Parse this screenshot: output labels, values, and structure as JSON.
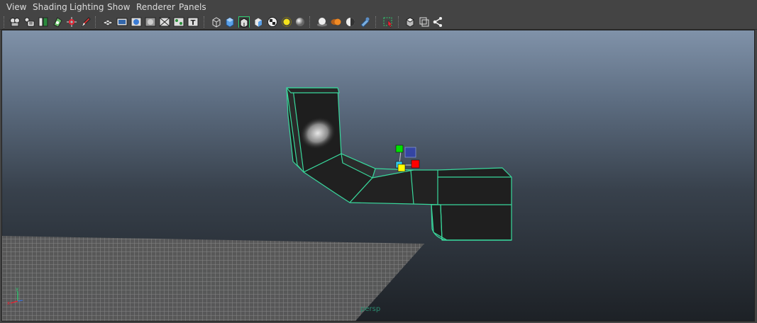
{
  "menubar": {
    "items": [
      "View",
      "Shading",
      "Lighting",
      "Show",
      "Renderer",
      "Panels"
    ]
  },
  "toolbar": {
    "icons": [
      "select-camera-icon",
      "camera-attributes-icon",
      "bookmark-icon",
      "image-plane-icon",
      "2d-pan-zoom-icon",
      "grease-pencil-icon",
      "grid-icon",
      "film-gate-icon",
      "resolution-gate-icon",
      "gate-mask-icon",
      "field-chart-icon",
      "safe-action-icon",
      "safe-title-icon",
      "wireframe-icon",
      "smooth-shade-icon",
      "wireframe-on-shaded-icon",
      "default-material-icon",
      "textured-icon",
      "use-all-lights-icon",
      "shadows-icon",
      "screen-space-ao-icon",
      "motion-blur-icon",
      "multisample-aa-icon",
      "depth-of-field-icon",
      "isolate-select-icon",
      "xray-icon",
      "xray-active-components-icon",
      "xray-joints-icon"
    ]
  },
  "viewport": {
    "camera_label": "persp",
    "background_top": "#8092a9",
    "background_bottom": "#1d2126",
    "wire_color": "#39d89c"
  },
  "manipulator": {
    "x_color": "#ff0000",
    "y_color": "#00e000",
    "z_color": "#3344aa",
    "center_color": "#ffff00"
  }
}
